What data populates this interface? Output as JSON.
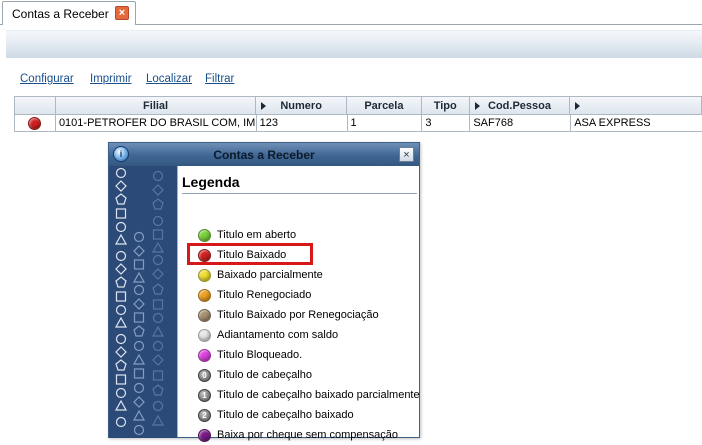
{
  "tab": {
    "label": "Contas a Receber",
    "close_glyph": "×"
  },
  "toolbar": {
    "configurar": "Configurar",
    "imprimir": "Imprimir",
    "localizar": "Localizar",
    "filtrar": "Filtrar"
  },
  "grid": {
    "headers": [
      "",
      "Filial",
      "Numero",
      "Parcela",
      "Tipo",
      "Cod.Pessoa",
      ""
    ],
    "rows": [
      {
        "status_color": "#d42020",
        "filial": "0101-PETROFER DO BRASIL COM, IM...",
        "numero": "123",
        "parcela": "1",
        "tipo": "3",
        "cod_pessoa": "SAF768",
        "nome": "ASA EXPRESS"
      }
    ]
  },
  "dialog": {
    "title": "Contas a Receber",
    "legend_title": "Legenda",
    "close_glyph": "×",
    "items": [
      {
        "label": "Titulo em aberto",
        "color": "#7bd23a",
        "icon": "green-led"
      },
      {
        "label": "Titulo Baixado",
        "color": "#d42020",
        "icon": "red-led"
      },
      {
        "label": "Baixado parcialmente",
        "color": "#f0e030",
        "icon": "yellow-led"
      },
      {
        "label": "Titulo Renegociado",
        "color": "#f0a020",
        "icon": "orange-led"
      },
      {
        "label": "Titulo Baixado por Renegociação",
        "color": "#a89070",
        "icon": "brown-led"
      },
      {
        "label": "Adiantamento com saldo",
        "color": "#e8e8e8",
        "icon": "white-led"
      },
      {
        "label": "Titulo Bloqueado.",
        "color": "#e040e0",
        "icon": "magenta-led"
      },
      {
        "label": "Titulo de cabeçalho",
        "number": "0",
        "icon": "numbered-0-icon"
      },
      {
        "label": "Titulo de cabeçalho baixado parcialmente",
        "number": "1",
        "icon": "numbered-1-icon"
      },
      {
        "label": "Titulo de cabeçalho baixado",
        "number": "2",
        "icon": "numbered-2-icon"
      },
      {
        "label": "Baixa por cheque sem compensação",
        "color": "#7a1a8a",
        "icon": "purple-led"
      }
    ],
    "highlight_color": "#d81818"
  }
}
